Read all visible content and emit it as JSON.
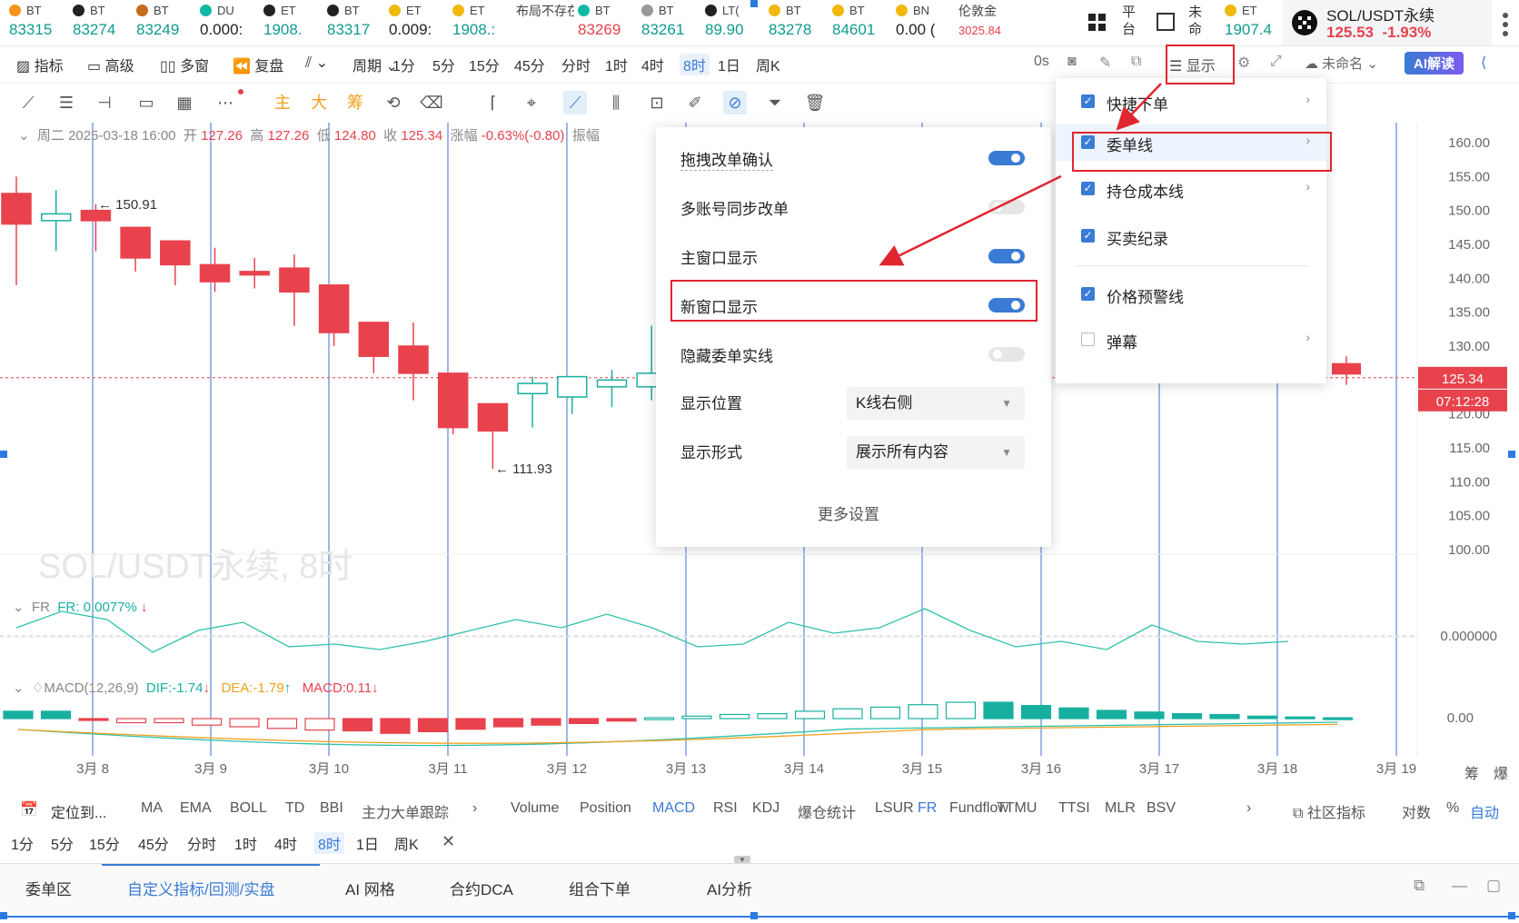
{
  "ticker": [
    {
      "sym": "BT",
      "val": "83315",
      "color": "teal",
      "icon": "bitcoin-icon",
      "icol": "#f7931a"
    },
    {
      "sym": "BT",
      "val": "83274",
      "color": "teal",
      "icon": "coin-black-icon",
      "icol": "#222"
    },
    {
      "sym": "BT",
      "val": "83249",
      "color": "teal",
      "icon": "coin-brown-icon",
      "icol": "#c66b1c"
    },
    {
      "sym": "DU",
      "val": "0.000:",
      "color": "blk",
      "icon": "coin-teal-icon",
      "icol": "#12b8a6"
    },
    {
      "sym": "ET",
      "val": "1908.",
      "color": "teal",
      "icon": "exchange-x-icon",
      "icol": "#222"
    },
    {
      "sym": "BT",
      "val": "83317",
      "color": "teal",
      "icon": "exchange-x-icon",
      "icol": "#222"
    },
    {
      "sym": "ET",
      "val": "0.009:",
      "color": "blk",
      "icon": "binance-icon",
      "icol": "#f0b90b"
    },
    {
      "sym": "ET",
      "val": "1908.:",
      "color": "teal",
      "icon": "binance-icon",
      "icol": "#f0b90b"
    },
    {
      "sym": "布局不存在",
      "val": "",
      "color": "blk",
      "icon": "",
      "icol": ""
    },
    {
      "sym": "BT",
      "val": "83269",
      "color": "red",
      "icon": "coin-teal-icon",
      "icol": "#12b8a6"
    },
    {
      "sym": "BT",
      "val": "83261",
      "color": "teal",
      "icon": "coin-gray-icon",
      "icol": "#999"
    },
    {
      "sym": "LT(",
      "val": "89.90",
      "color": "teal",
      "icon": "exchange-x-icon",
      "icol": "#222"
    },
    {
      "sym": "BT",
      "val": "83278",
      "color": "teal",
      "icon": "binance-icon",
      "icol": "#f0b90b"
    },
    {
      "sym": "BT",
      "val": "84601",
      "color": "teal",
      "icon": "binance-icon",
      "icol": "#f0b90b"
    },
    {
      "sym": "BN",
      "val": "0.00 (",
      "color": "blk",
      "icon": "binance-icon",
      "icol": "#f0b90b"
    },
    {
      "sym": "伦敦金",
      "val": "3025.84",
      "color": "red",
      "icon": "",
      "icol": ""
    }
  ],
  "ticker_tail": {
    "platform": "平台",
    "unnamed": "未命",
    "eth_sym": "ET",
    "eth_val": "1907.4"
  },
  "sol": {
    "name": "SOL/USDT永续",
    "price": "125.53",
    "change": "-1.93%"
  },
  "toolbar": {
    "indicator": "指标",
    "advanced": "高级",
    "multiwin": "多窗",
    "replay": "复盘",
    "period": "周期",
    "periods": [
      "1分",
      "5分",
      "15分",
      "45分",
      "分时",
      "1时",
      "4时",
      "8时",
      "1日",
      "周K"
    ],
    "active_period": "8时",
    "time_os": "0s",
    "display": "显示",
    "unnamed": "未命名",
    "ai": "AI解读"
  },
  "drawtools": {
    "main": "主",
    "big": "大",
    "chip": "筹"
  },
  "info": {
    "date": "周二 2025-03-18 16:00",
    "open_lbl": "开",
    "open": "127.26",
    "high_lbl": "高",
    "high": "127.26",
    "low_lbl": "低",
    "low": "124.80",
    "close_lbl": "收",
    "close": "125.34",
    "chg_lbl": "涨幅",
    "chg": "-0.63%(-0.80)",
    "amp_lbl": "振幅"
  },
  "chart_data": {
    "type": "candlestick",
    "title": "SOL/USDT永续, 8时",
    "candles": [
      {
        "o": 152.5,
        "h": 155,
        "l": 139,
        "c": 148.0
      },
      {
        "o": 148.5,
        "h": 153,
        "l": 144,
        "c": 149.5
      },
      {
        "o": 150.0,
        "h": 150.9,
        "l": 144,
        "c": 148.5
      },
      {
        "o": 147.5,
        "h": 147.5,
        "l": 141,
        "c": 143.0
      },
      {
        "o": 145.5,
        "h": 145.5,
        "l": 139,
        "c": 142.0
      },
      {
        "o": 142.0,
        "h": 144.5,
        "l": 138,
        "c": 139.5
      },
      {
        "o": 141.0,
        "h": 143.0,
        "l": 138.5,
        "c": 140.5
      },
      {
        "o": 141.5,
        "h": 143.5,
        "l": 133,
        "c": 138.0
      },
      {
        "o": 139.0,
        "h": 139.0,
        "l": 130,
        "c": 132.0
      },
      {
        "o": 133.5,
        "h": 133.5,
        "l": 126,
        "c": 128.5
      },
      {
        "o": 130.0,
        "h": 133.5,
        "l": 122,
        "c": 126.0
      },
      {
        "o": 126.0,
        "h": 126.0,
        "l": 117,
        "c": 118.0
      },
      {
        "o": 121.5,
        "h": 121.5,
        "l": 111.93,
        "c": 117.5
      },
      {
        "o": 123.0,
        "h": 125.5,
        "l": 118,
        "c": 124.5
      },
      {
        "o": 122.5,
        "h": 125.5,
        "l": 120,
        "c": 125.5
      },
      {
        "o": 124.0,
        "h": 126.5,
        "l": 121,
        "c": 125.0
      },
      {
        "o": 124.0,
        "h": 133.0,
        "l": 122,
        "c": 126.0
      },
      {
        "o": 131.0,
        "h": 131.0,
        "l": 124,
        "c": 129.5
      },
      {
        "o": 130.0,
        "h": 130.0,
        "l": 125.5,
        "c": 128.0
      },
      {
        "o": 129.0,
        "h": 129.0,
        "l": 124.5,
        "c": 127.0
      },
      {
        "o": 128.5,
        "h": 128.5,
        "l": 123.5,
        "c": 125.8
      },
      {
        "o": 127.26,
        "h": 127.26,
        "l": 124.8,
        "c": 125.34
      }
    ],
    "markers": {
      "high": "150.91",
      "low": "111.93"
    },
    "yaxis": [
      "160.00",
      "155.00",
      "150.00",
      "145.00",
      "140.00",
      "135.00",
      "130.00",
      "125.34",
      "120.00",
      "115.00",
      "110.00",
      "105.00",
      "100.00"
    ],
    "price_tag": "125.34",
    "time_tag": "07:12:28",
    "xaxis": [
      "3月 8",
      "3月 9",
      "3月 10",
      "3月 11",
      "3月 12",
      "3月 13",
      "3月 14",
      "3月 15",
      "3月 16",
      "3月 17",
      "3月 18",
      "3月 19"
    ],
    "fr": {
      "label": "FR",
      "value": "FR: 0.0077%",
      "axis": "0.000000",
      "values": [
        0.3,
        0.9,
        0.6,
        -0.6,
        0.2,
        0.5,
        -0.4,
        -0.3,
        -0.5,
        -0.2,
        0.2,
        0.6,
        0.3,
        0.8,
        0.3,
        -0.4,
        -0.3,
        0.5,
        0.1,
        0.3,
        1.0,
        0.2,
        -0.4,
        -0.2,
        -0.5,
        0.4,
        -0.2,
        -0.3,
        -0.2
      ]
    },
    "macd": {
      "label": "MACD(12,26,9)",
      "dif": "DIF:-1.74",
      "dea": "DEA:-1.79",
      "macd": "MACD:0.11",
      "axis": "0.00",
      "hist": [
        0.9,
        0.9,
        -0.2,
        -0.5,
        -0.5,
        -0.8,
        -1.0,
        -1.2,
        -1.4,
        -1.5,
        -1.8,
        -1.6,
        -1.3,
        -1.0,
        -0.8,
        -0.6,
        -0.3,
        0.1,
        0.3,
        0.5,
        0.6,
        0.9,
        1.2,
        1.4,
        1.7,
        2.0,
        2.0,
        1.6,
        1.3,
        1.0,
        0.8,
        0.6,
        0.5,
        0.3,
        0.2,
        0.1
      ]
    }
  },
  "indicators": {
    "locate": "定位到...",
    "main": [
      "MA",
      "EMA",
      "BOLL",
      "TD",
      "BBI",
      "主力大单跟踪"
    ],
    "sub": [
      "Volume",
      "Position",
      "MACD",
      "RSI",
      "KDJ",
      "爆仓统计",
      "LSUR",
      "FR",
      "Fundflow",
      "TTMU",
      "TTSI",
      "MLR",
      "BSV"
    ],
    "community": "社区指标",
    "log": "对数",
    "pct": "%",
    "auto": "自动"
  },
  "periods2": [
    "1分",
    "5分",
    "15分",
    "45分",
    "分时",
    "1时",
    "4时",
    "8时",
    "1日",
    "周K"
  ],
  "bottom_tabs": [
    "委单区",
    "自定义指标/回测/实盘",
    "AI 网格",
    "合约DCA",
    "组合下单",
    "AI分析"
  ],
  "settings_panel": {
    "rows": [
      {
        "label": "拖拽改单确认",
        "toggle": true
      },
      {
        "label": "多账号同步改单",
        "toggle": false
      },
      {
        "label": "主窗口显示",
        "toggle": true
      },
      {
        "label": "新窗口显示",
        "toggle": true
      },
      {
        "label": "隐藏委单实线",
        "toggle": false
      }
    ],
    "position_label": "显示位置",
    "position_value": "K线右侧",
    "format_label": "显示形式",
    "format_value": "展示所有内容",
    "more": "更多设置"
  },
  "display_menu": {
    "items": [
      {
        "label": "快捷下单",
        "checked": true,
        "arrow": true
      },
      {
        "label": "委单线",
        "checked": true,
        "arrow": true
      },
      {
        "label": "持仓成本线",
        "checked": true,
        "arrow": true
      },
      {
        "label": "买卖纪录",
        "checked": true,
        "arrow": false
      },
      {
        "label": "价格预警线",
        "checked": true,
        "arrow": false
      },
      {
        "label": "弹幕",
        "checked": false,
        "arrow": true
      }
    ]
  },
  "right_edge": {
    "chip": "筹",
    "burst": "爆"
  },
  "colors": {
    "up": "#17b09f",
    "down": "#e8424d",
    "accent": "#3a7bd5",
    "annotation": "#e0262f"
  }
}
